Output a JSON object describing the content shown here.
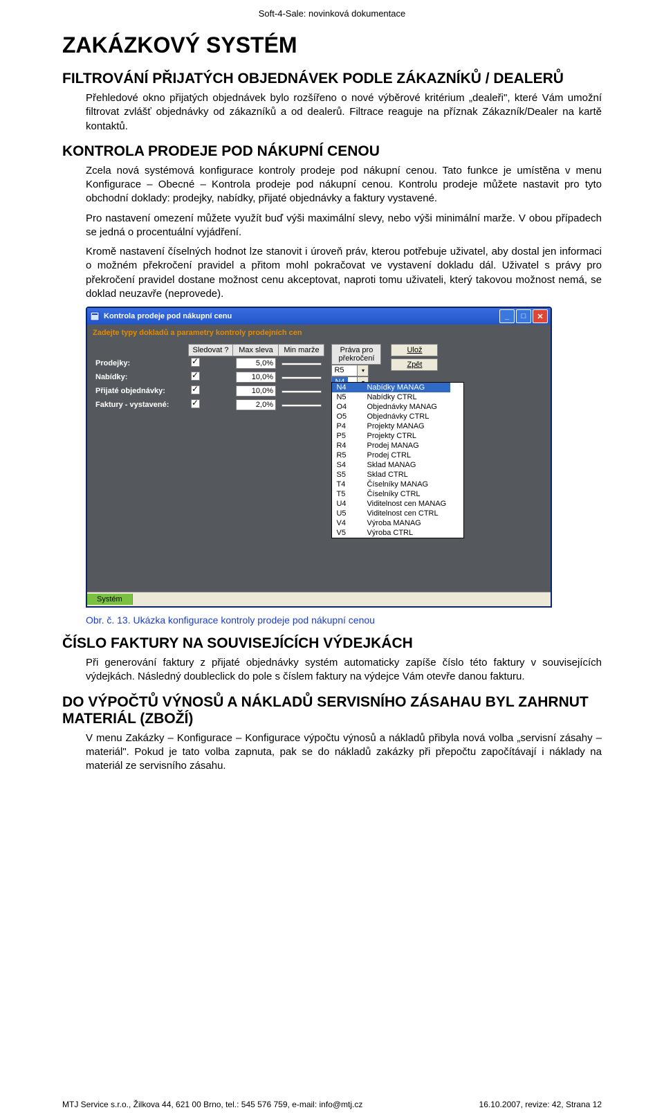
{
  "header": "Soft-4-Sale: novinková dokumentace",
  "h1": "ZAKÁZKOVÝ SYSTÉM",
  "sec1": {
    "title_upper": "F",
    "title_rest": "ILTROVÁNÍ PŘIJATÝCH OBJEDNÁVEK PODLE ZÁKAZNÍKŮ / DEALERŮ",
    "p1": "Přehledové okno přijatých objednávek bylo rozšířeno o nové výběrové kritérium „dealeři\", které Vám umožní filtrovat zvlášť objednávky od zákazníků a od dealerů. Filtrace reaguje na příznak Zákazník/Dealer na kartě kontaktů."
  },
  "sec2": {
    "title_upper": "K",
    "title_rest": "ONTROLA PRODEJE POD NÁKUPNÍ CENOU",
    "p1": "Zcela nová systémová konfigurace kontroly prodeje pod nákupní cenou. Tato funkce je umístěna v menu Konfigurace – Obecné – Kontrola prodeje pod nákupní cenou. Kontrolu prodeje můžete nastavit pro tyto obchodní doklady: prodejky, nabídky, přijaté objednávky a faktury vystavené.",
    "p2": "Pro nastavení omezení můžete využít buď výši maximální slevy, nebo výši minimální marže. V obou případech se jedná o procentuální vyjádření.",
    "p3": "Kromě nastavení číselných hodnot lze stanovit i úroveň práv, kterou potřebuje uživatel, aby dostal jen informaci o možném překročení pravidel a přitom mohl pokračovat ve vystavení dokladu dál. Uživatel s právy pro překročení pravidel dostane možnost cenu akceptovat, naproti tomu uživateli, který takovou možnost nemá, se doklad neuzavře (neprovede)."
  },
  "window": {
    "title": "Kontrola prodeje pod nákupní cenu",
    "instruction": "Zadejte typy dokladů a parametry kontroly prodejních cen",
    "headers": {
      "watch": "Sledovat ?",
      "maxsleva": "Max sleva",
      "minmarze": "Min marže",
      "rights": "Práva pro překročení"
    },
    "rows": [
      {
        "label": "Prodejky:",
        "checked": true,
        "max": "5,0%",
        "sel": "R5",
        "hl": false
      },
      {
        "label": "Nabídky:",
        "checked": true,
        "max": "10,0%",
        "sel": "N4",
        "hl": true
      },
      {
        "label": "Přijaté objednávky:",
        "checked": true,
        "max": "10,0%",
        "sel": "",
        "hl": false
      },
      {
        "label": "Faktury - vystavené:",
        "checked": true,
        "max": "2,0%",
        "sel": "",
        "hl": false
      }
    ],
    "buttons": {
      "save": "Ulož",
      "back": "Zpět"
    },
    "dropdown": [
      {
        "code": "N4",
        "desc": "Nabídky MANAG",
        "hl": true
      },
      {
        "code": "N5",
        "desc": "Nabídky CTRL"
      },
      {
        "code": "O4",
        "desc": "Objednávky MANAG"
      },
      {
        "code": "O5",
        "desc": "Objednávky CTRL"
      },
      {
        "code": "P4",
        "desc": "Projekty MANAG"
      },
      {
        "code": "P5",
        "desc": "Projekty CTRL"
      },
      {
        "code": "R4",
        "desc": "Prodej MANAG"
      },
      {
        "code": "R5",
        "desc": "Prodej CTRL"
      },
      {
        "code": "S4",
        "desc": "Sklad MANAG"
      },
      {
        "code": "S5",
        "desc": "Sklad CTRL"
      },
      {
        "code": "T4",
        "desc": "Číselníky MANAG"
      },
      {
        "code": "T5",
        "desc": "Číselníky CTRL"
      },
      {
        "code": "U4",
        "desc": "Viditelnost cen MANAG"
      },
      {
        "code": "U5",
        "desc": "Viditelnost cen CTRL"
      },
      {
        "code": "V4",
        "desc": "Výroba MANAG"
      },
      {
        "code": "V5",
        "desc": "Výroba CTRL"
      }
    ],
    "status": "Systém"
  },
  "caption": "Obr. č. 13. Ukázka konfigurace kontroly prodeje pod nákupní cenou",
  "sec3": {
    "title_upper": "Č",
    "title_rest": "ÍSLO FAKTURY NA SOUVISEJÍCÍCH VÝDEJKÁCH",
    "p1": "Při generování faktury z přijaté objednávky systém automaticky zapíše číslo této faktury v souvisejících výdejkách. Následný doubleclick do pole s číslem faktury na výdejce Vám otevře danou fakturu."
  },
  "sec4": {
    "title_upper": "D",
    "title_rest": "O VÝPOČTŮ VÝNOSŮ A NÁKLADŮ SERVISNÍHO ZÁSAHAU BYL ZAHRNUT MATERIÁL (ZBOŽÍ)",
    "p1": "V menu Zakázky – Konfigurace – Konfigurace výpočtu výnosů a nákladů přibyla nová volba „servisní zásahy – materiál\". Pokud je tato volba zapnuta, pak se do nákladů zakázky při přepočtu započítávají i náklady na materiál ze servisního zásahu."
  },
  "footer": {
    "left": "MTJ Service s.r.o., Žilkova 44, 621 00 Brno, tel.: 545 576 759, e-mail: info@mtj.cz",
    "right": "16.10.2007, revize: 42, Strana 12"
  }
}
